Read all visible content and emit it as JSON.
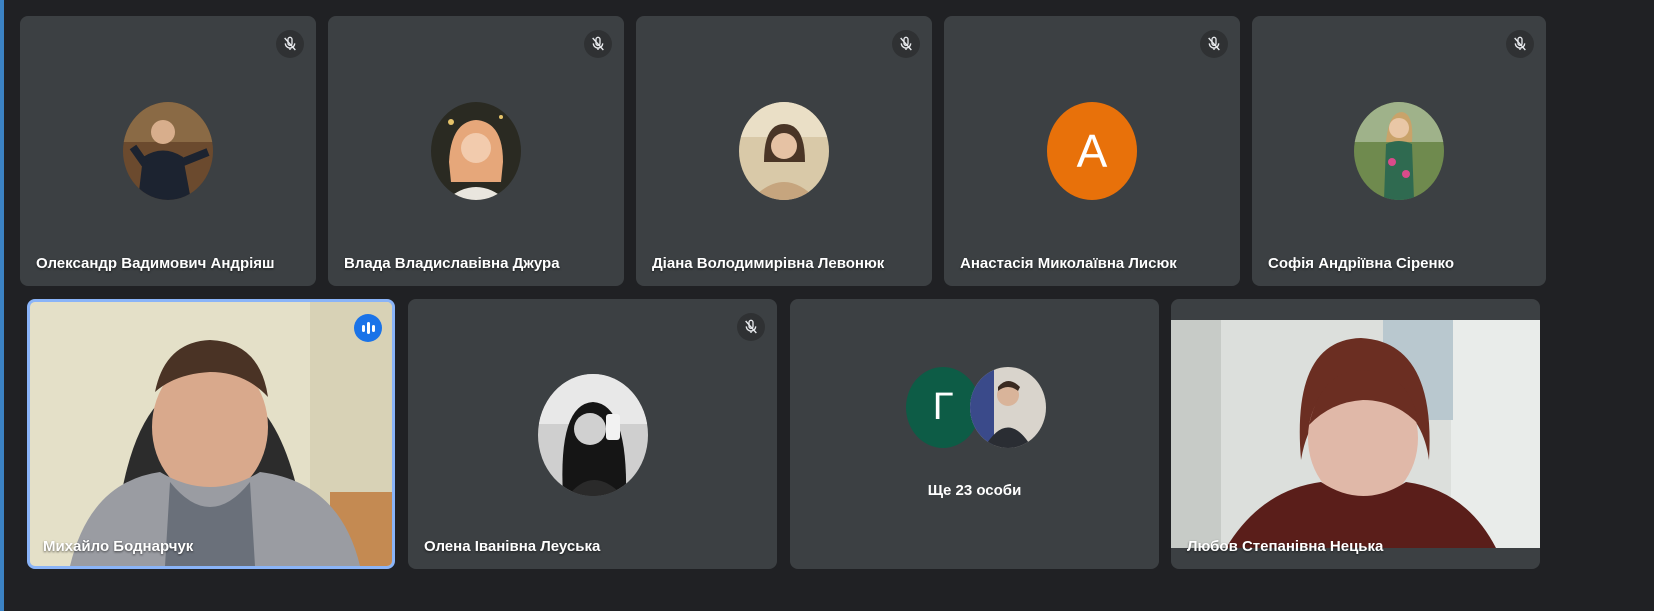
{
  "colors": {
    "background": "#202124",
    "tile": "#3c4043",
    "active_border": "#8ab4f8",
    "speaking_indicator": "#1a73e8",
    "avatar_orange": "#e8710a",
    "avatar_green": "#0d5c46"
  },
  "participants_row1": [
    {
      "name": "Олександр Вадимович Андріяш",
      "muted": true,
      "avatar": "photo"
    },
    {
      "name": "Влада Владиславівна Джура",
      "muted": true,
      "avatar": "photo"
    },
    {
      "name": "Діана Володимирівна Левонюк",
      "muted": true,
      "avatar": "photo"
    },
    {
      "name": "Анастасія Миколаївна Лисюк",
      "muted": true,
      "avatar": "letter",
      "letter": "А"
    },
    {
      "name": "Софія Андріївна Сіренко",
      "muted": true,
      "avatar": "photo"
    }
  ],
  "participants_row2": [
    {
      "name": "Михайло Боднарчук",
      "speaking": true,
      "video": true
    },
    {
      "name": "Олена Іванівна Леуська",
      "muted": true,
      "avatar": "photo"
    },
    {
      "more_label": "Ще 23 особи",
      "letter": "Г"
    },
    {
      "name": "Любов Степанівна Нецька",
      "video": true
    }
  ],
  "icons": {
    "muted": "mic-off-icon",
    "speaking": "audio-level-icon"
  }
}
